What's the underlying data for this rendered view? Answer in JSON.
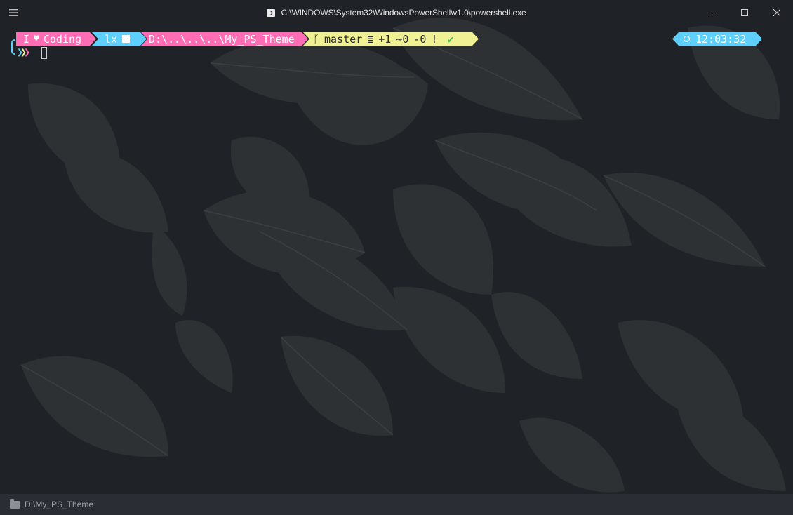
{
  "window": {
    "title": "C:\\WINDOWS\\System32\\WindowsPowerShell\\v1.0\\powershell.exe",
    "menu_icon": "hamburger-icon",
    "controls": [
      "minimize-icon",
      "maximize-icon",
      "close-icon"
    ]
  },
  "prompt": {
    "seg1": {
      "text_a": "I",
      "icon": "heart-icon",
      "text_b": "Coding",
      "color": "#ff6eb4"
    },
    "seg2": {
      "text": "lx",
      "icon": "windows-icon",
      "color": "#5fd0fb"
    },
    "seg3": {
      "text": "D:\\..\\..\\..\\My_PS_Theme",
      "color": "#ff6eb4"
    },
    "seg4": {
      "branch_icon": "git-branch-icon",
      "branch": "master",
      "sync": "≣",
      "added": "+1",
      "modified": "~0",
      "deleted": "-0",
      "flag": "!",
      "status_icon": "check-icon",
      "color": "#f0f094"
    },
    "time": {
      "icon": "clock-icon",
      "text": "12:03:32",
      "color": "#5fd0fb"
    }
  },
  "input_line": {
    "chevron_colors": [
      "#5fd0fb",
      "#f0f094",
      "#ff6eb4"
    ],
    "chevron_glyph": "❯"
  },
  "statusbar": {
    "icon": "folder-icon",
    "path": "D:\\My_PS_Theme"
  }
}
